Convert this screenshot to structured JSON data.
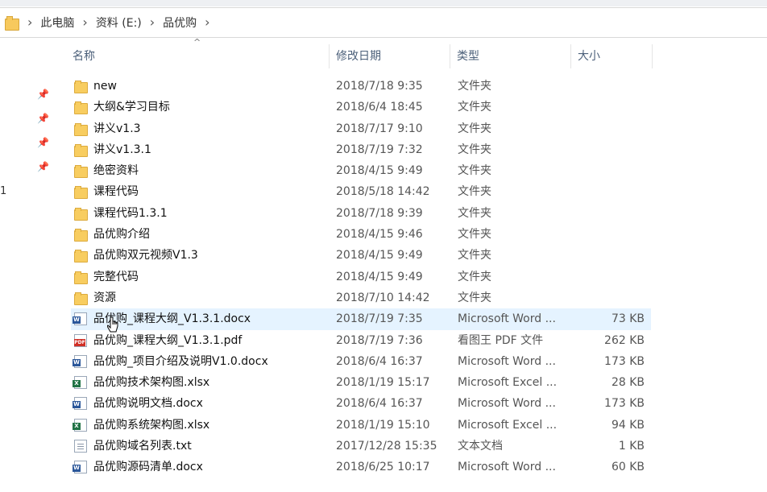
{
  "breadcrumb": [
    "此电脑",
    "资料 (E:)",
    "品优购"
  ],
  "columns": {
    "name": "名称",
    "date": "修改日期",
    "type": "类型",
    "size": "大小"
  },
  "left_label": "1",
  "files": [
    {
      "name": "new",
      "date": "2018/7/18 9:35",
      "type": "文件夹",
      "size": "",
      "icon": "folder-icon"
    },
    {
      "name": "大纲&学习目标",
      "date": "2018/6/4 18:45",
      "type": "文件夹",
      "size": "",
      "icon": "folder-icon"
    },
    {
      "name": "讲义v1.3",
      "date": "2018/7/17 9:10",
      "type": "文件夹",
      "size": "",
      "icon": "folder-icon"
    },
    {
      "name": "讲义v1.3.1",
      "date": "2018/7/19 7:32",
      "type": "文件夹",
      "size": "",
      "icon": "folder-icon"
    },
    {
      "name": "绝密资料",
      "date": "2018/4/15 9:49",
      "type": "文件夹",
      "size": "",
      "icon": "folder-icon"
    },
    {
      "name": "课程代码",
      "date": "2018/5/18 14:42",
      "type": "文件夹",
      "size": "",
      "icon": "folder-icon"
    },
    {
      "name": "课程代码1.3.1",
      "date": "2018/7/18 9:39",
      "type": "文件夹",
      "size": "",
      "icon": "folder-icon"
    },
    {
      "name": "品优购介绍",
      "date": "2018/4/15 9:46",
      "type": "文件夹",
      "size": "",
      "icon": "folder-icon"
    },
    {
      "name": "品优购双元视频V1.3",
      "date": "2018/4/15 9:49",
      "type": "文件夹",
      "size": "",
      "icon": "folder-icon"
    },
    {
      "name": "完整代码",
      "date": "2018/4/15 9:49",
      "type": "文件夹",
      "size": "",
      "icon": "folder-icon"
    },
    {
      "name": "资源",
      "date": "2018/7/10 14:42",
      "type": "文件夹",
      "size": "",
      "icon": "folder-icon"
    },
    {
      "name": "品优购_课程大纲_V1.3.1.docx",
      "date": "2018/7/19 7:35",
      "type": "Microsoft Word ...",
      "size": "73 KB",
      "icon": "word-doc-icon"
    },
    {
      "name": "品优购_课程大纲_V1.3.1.pdf",
      "date": "2018/7/19 7:36",
      "type": "看图王 PDF 文件",
      "size": "262 KB",
      "icon": "pdf-icon"
    },
    {
      "name": "品优购_项目介绍及说明V1.0.docx",
      "date": "2018/6/4 16:37",
      "type": "Microsoft Word ...",
      "size": "173 KB",
      "icon": "word-doc-icon"
    },
    {
      "name": "品优购技术架构图.xlsx",
      "date": "2018/1/19 15:17",
      "type": "Microsoft Excel ...",
      "size": "28 KB",
      "icon": "excel-sheet-icon"
    },
    {
      "name": "品优购说明文档.docx",
      "date": "2018/6/4 16:37",
      "type": "Microsoft Word ...",
      "size": "173 KB",
      "icon": "word-doc-icon"
    },
    {
      "name": "品优购系统架构图.xlsx",
      "date": "2018/1/19 15:10",
      "type": "Microsoft Excel ...",
      "size": "94 KB",
      "icon": "excel-sheet-icon"
    },
    {
      "name": "品优购域名列表.txt",
      "date": "2017/12/28 15:35",
      "type": "文本文档",
      "size": "1 KB",
      "icon": "text-file-icon"
    },
    {
      "name": "品优购源码清单.docx",
      "date": "2018/6/25 10:17",
      "type": "Microsoft Word ...",
      "size": "60 KB",
      "icon": "word-doc-icon"
    }
  ],
  "hovered_row": 11,
  "colors": {
    "hover_row": "#e5f3ff",
    "folder": "#f8cd60",
    "header_text": "#4c607a"
  }
}
